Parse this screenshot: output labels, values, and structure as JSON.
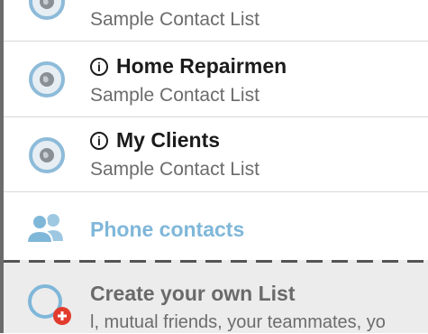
{
  "lists": [
    {
      "name": "",
      "subtitle": "Sample Contact List"
    },
    {
      "name": "Home Repairmen",
      "subtitle": "Sample Contact List"
    },
    {
      "name": "My Clients",
      "subtitle": "Sample Contact List"
    }
  ],
  "info_glyph": "i",
  "phone_contacts": {
    "label": "Phone contacts"
  },
  "create_list": {
    "title": "Create your own List",
    "description": "l, mutual friends, your teammates, yo"
  },
  "colors": {
    "accent_blue": "#7fb7d9",
    "add_badge_red": "#e23b2e",
    "text_dark": "#1b1b1b",
    "text_gray": "#6c6c6c"
  },
  "icons": [
    "globe-icon",
    "info-icon",
    "people-icon",
    "add-list-icon"
  ]
}
